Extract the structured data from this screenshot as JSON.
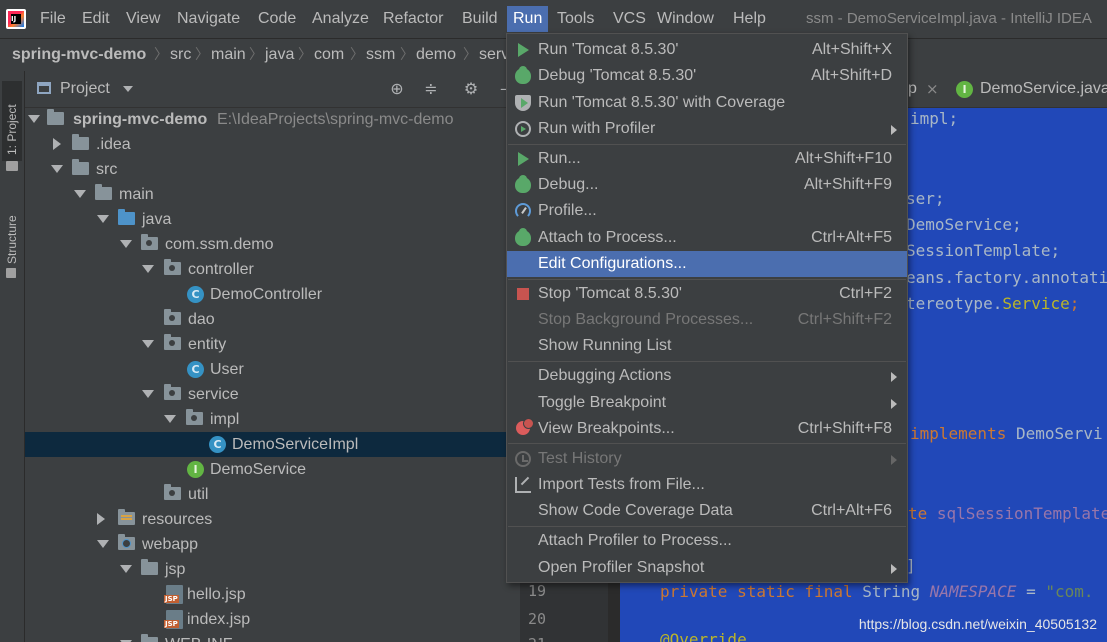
{
  "menubar": {
    "items": [
      "File",
      "Edit",
      "View",
      "Navigate",
      "Code",
      "Analyze",
      "Refactor",
      "Build",
      "Run",
      "Tools",
      "VCS",
      "Window",
      "Help"
    ],
    "active": "Run",
    "window_title": "ssm - DemoServiceImpl.java - IntelliJ IDEA"
  },
  "breadcrumb": [
    "spring-mvc-demo",
    "src",
    "main",
    "java",
    "com",
    "ssm",
    "demo",
    "serv"
  ],
  "toolstrip": {
    "project_tab": "1: Project",
    "structure_tab": "Z: Structure"
  },
  "project_panel": {
    "title": "Project",
    "tree": [
      {
        "label": "spring-mvc-demo",
        "path": "E:\\IdeaProjects\\spring-mvc-demo"
      },
      {
        "label": ".idea"
      },
      {
        "label": "src"
      },
      {
        "label": "main"
      },
      {
        "label": "java"
      },
      {
        "label": "com.ssm.demo"
      },
      {
        "label": "controller"
      },
      {
        "label": "DemoController"
      },
      {
        "label": "dao"
      },
      {
        "label": "entity"
      },
      {
        "label": "User"
      },
      {
        "label": "service"
      },
      {
        "label": "impl"
      },
      {
        "label": "DemoServiceImpl"
      },
      {
        "label": "DemoService"
      },
      {
        "label": "util"
      },
      {
        "label": "resources"
      },
      {
        "label": "webapp"
      },
      {
        "label": "jsp"
      },
      {
        "label": "hello.jsp"
      },
      {
        "label": "index.jsp"
      },
      {
        "label": "WEB-INF"
      }
    ]
  },
  "editor": {
    "tabs": [
      {
        "label": "p",
        "close": "×"
      },
      {
        "label": "DemoService.java"
      }
    ],
    "code_fragments": {
      "l1": "impl;",
      "l2": "ser;",
      "l3": "DemoService;",
      "l4": "SessionTemplate;",
      "l5": "eans.factory.annotati",
      "l6a": "tereotype.",
      "l6b": "Service",
      "l6c": ";",
      "l7a": "implements",
      "l7b": " DemoServi",
      "l8a": "te ",
      "l8b": "sqlSessionTemplate",
      "l9": "]",
      "l19a": "private static final ",
      "l19b": "String ",
      "l19c": "NAMESPACE",
      "l19d": " = ",
      "l19e": "\"com.",
      "l21": "@Override"
    },
    "line_numbers": [
      "19",
      "20",
      "21"
    ]
  },
  "run_menu": {
    "items": [
      {
        "label": "Run 'Tomcat 8.5.30'",
        "shortcut": "Alt+Shift+X"
      },
      {
        "label": "Debug 'Tomcat 8.5.30'",
        "shortcut": "Alt+Shift+D"
      },
      {
        "label": "Run 'Tomcat 8.5.30' with Coverage",
        "shortcut": ""
      },
      {
        "label": "Run with Profiler",
        "shortcut": ""
      },
      {
        "label": "Run...",
        "shortcut": "Alt+Shift+F10"
      },
      {
        "label": "Debug...",
        "shortcut": "Alt+Shift+F9"
      },
      {
        "label": "Profile...",
        "shortcut": ""
      },
      {
        "label": "Attach to Process...",
        "shortcut": "Ctrl+Alt+F5"
      },
      {
        "label": "Edit Configurations...",
        "shortcut": ""
      },
      {
        "label": "Stop 'Tomcat 8.5.30'",
        "shortcut": "Ctrl+F2"
      },
      {
        "label": "Stop Background Processes...",
        "shortcut": "Ctrl+Shift+F2"
      },
      {
        "label": "Show Running List",
        "shortcut": ""
      },
      {
        "label": "Debugging Actions",
        "shortcut": ""
      },
      {
        "label": "Toggle Breakpoint",
        "shortcut": ""
      },
      {
        "label": "View Breakpoints...",
        "shortcut": "Ctrl+Shift+F8"
      },
      {
        "label": "Test History",
        "shortcut": ""
      },
      {
        "label": "Import Tests from File...",
        "shortcut": ""
      },
      {
        "label": "Show Code Coverage Data",
        "shortcut": "Ctrl+Alt+F6"
      },
      {
        "label": "Attach Profiler to Process...",
        "shortcut": ""
      },
      {
        "label": "Open Profiler Snapshot",
        "shortcut": ""
      }
    ]
  },
  "watermark": "https://blog.csdn.net/weixin_40505132",
  "colors": {
    "highlight": "#4b6eaf",
    "background": "#3c3f41",
    "editor_selection": "#2148b8"
  }
}
